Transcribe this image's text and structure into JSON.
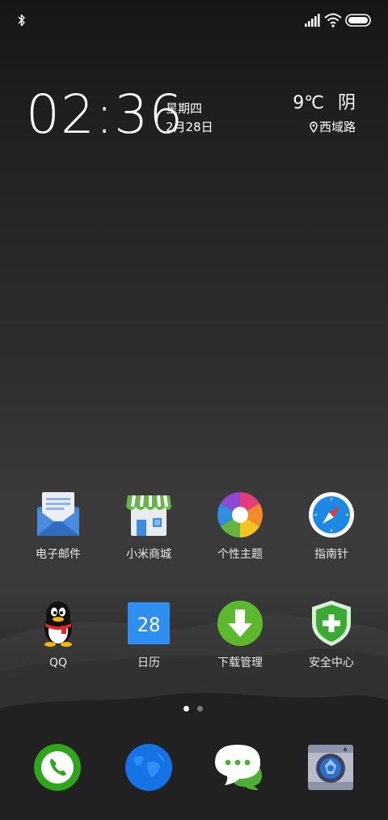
{
  "status_bar": {
    "icons": [
      "bluetooth-icon",
      "signal-icon",
      "wifi-icon",
      "battery-icon"
    ]
  },
  "clock_widget": {
    "time": "02:36",
    "weekday": "星期四",
    "date": "2月28日"
  },
  "weather_widget": {
    "temperature": "9℃",
    "condition": "阴",
    "location": "西域路"
  },
  "home_apps": [
    {
      "label": "电子邮件",
      "icon": "email-icon"
    },
    {
      "label": "小米商城",
      "icon": "store-icon"
    },
    {
      "label": "个性主题",
      "icon": "theme-icon"
    },
    {
      "label": "指南针",
      "icon": "compass-icon"
    },
    {
      "label": "QQ",
      "icon": "qq-penguin-icon"
    },
    {
      "label": "日历",
      "icon": "calendar-icon",
      "badge": "28"
    },
    {
      "label": "下载管理",
      "icon": "download-icon"
    },
    {
      "label": "安全中心",
      "icon": "security-shield-icon"
    }
  ],
  "page_indicator": {
    "pages": 2,
    "current": 1
  },
  "dock": [
    {
      "name": "phone",
      "icon": "phone-icon"
    },
    {
      "name": "browser",
      "icon": "globe-icon"
    },
    {
      "name": "messages",
      "icon": "message-icon"
    },
    {
      "name": "camera",
      "icon": "camera-icon"
    }
  ],
  "colors": {
    "email_blue": "#3f7fd6",
    "store_green": "#63b645",
    "compass_blue": "#1e88e5",
    "calendar_blue": "#2f8ff0",
    "download_green": "#5cb82d",
    "shield_green": "#3aaa35",
    "phone_green": "#2fa51c",
    "globe_blue": "#1673e6"
  }
}
